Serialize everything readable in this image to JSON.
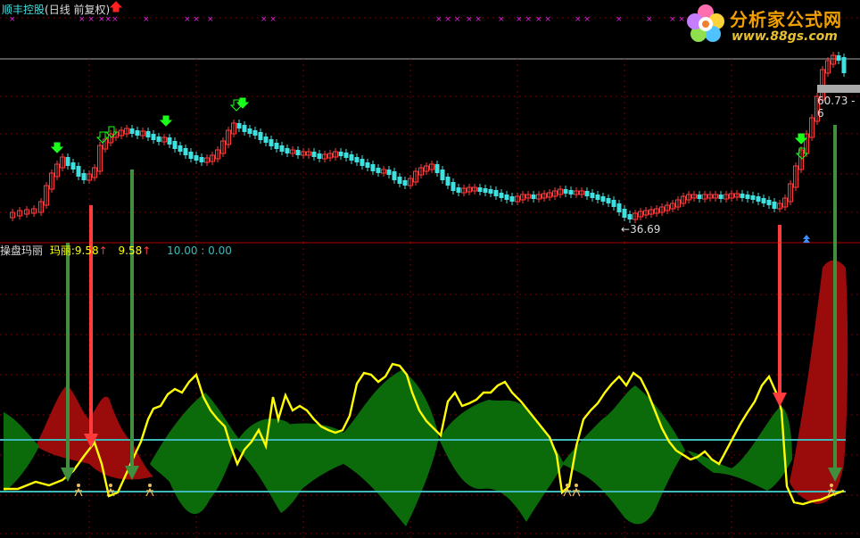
{
  "title": "顺丰控股",
  "period": "(日线 前复权)",
  "indicator": {
    "name": "操盘玛丽",
    "label": "玛丽:",
    "val1": "9.58",
    "val2": "9.58",
    "val3": "10.00",
    "val4": "0.00"
  },
  "low_label": "36.69",
  "price_label": "60.73 - 6",
  "logo": {
    "name": "分析家公式网",
    "url": "www.88gs.com"
  },
  "colors": {
    "up": "#ff3b3b",
    "down": "#3fe0e0",
    "green_fill": "#0b6b0b",
    "red_fill": "#9a0b0b",
    "yellow": "#ffff00",
    "cyan_line": "#3fb8b8",
    "grid": "#7a0000"
  }
}
